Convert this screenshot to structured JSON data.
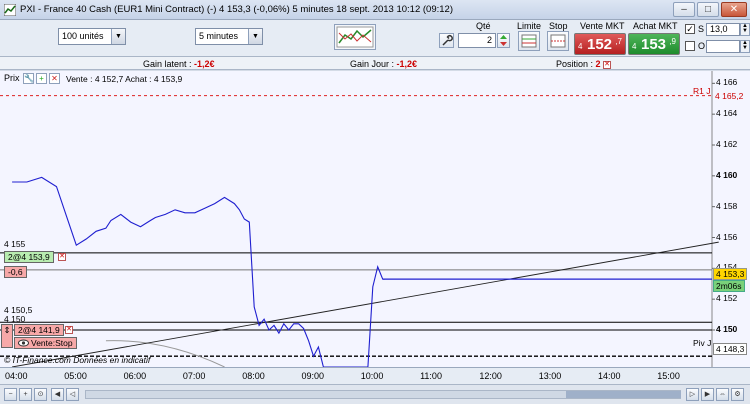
{
  "window": {
    "title": "PXI - France 40 Cash (EUR1 Mini Contract) (-)    4 153,3 (-0,06%)    5 minutes   18 sept. 2013 10:12 (09:12)",
    "min_glyph": "–",
    "max_glyph": "□",
    "close_glyph": "✕"
  },
  "toolbar": {
    "units": "100 unités",
    "period": "5 minutes",
    "qty_label": "Qté",
    "qty_value": "2",
    "limit_label": "Limite",
    "stop_label": "Stop",
    "sell_label": "Vente MKT",
    "buy_label": "Achat MKT",
    "sell_price": {
      "prefix": "4",
      "main": "152",
      "sup": ",7"
    },
    "buy_price": {
      "prefix": "4",
      "main": "153",
      "sup": ",9"
    },
    "s_label": "S",
    "o_label": "O",
    "s_value": "13,0",
    "o_value": ""
  },
  "infobar": {
    "latent_label": "Gain latent : ",
    "latent_value": "-1,2€",
    "day_label": "Gain Jour : ",
    "day_value": "-1,2€",
    "position_label": "Position : ",
    "position_value": "2"
  },
  "chart": {
    "prix_label": "Prix",
    "header": "Vente : 4 152,7 Achat : 4 153,9",
    "copyright": "© IT-Finance.com  Données en indicatif",
    "r1_label": "R1 J",
    "r1_value": "4 165,2",
    "piv_label": "Piv J",
    "piv_value": "4 148,3",
    "current_price": "4 153,3",
    "timer": "2m06s",
    "level_labels": {
      "l4155": "4 155",
      "l41505": "4 150,5",
      "l4150": "4 150"
    },
    "position_tag": "2@4 153,9",
    "pl_tag": "-0,6",
    "order_tag": "2@4 141,9",
    "order_button": "Vente:Stop"
  },
  "chart_data": {
    "type": "line",
    "y_ticks": [
      "4 166",
      "4 164",
      "4 162",
      "4 160",
      "4 158",
      "4 156",
      "4 154",
      "4 152",
      "4 150"
    ],
    "x_ticks": [
      "04:00",
      "05:00",
      "06:00",
      "07:00",
      "08:00",
      "09:00",
      "10:00",
      "11:00",
      "12:00",
      "13:00",
      "14:00",
      "15:00"
    ],
    "ylim": [
      4147.6,
      4166.8
    ],
    "series": [
      {
        "color": "#1f1fd0",
        "x": [
          "03:55",
          "04:10",
          "04:25",
          "04:40",
          "04:50",
          "05:00",
          "05:10",
          "05:20",
          "05:30",
          "05:35",
          "05:45",
          "05:55",
          "06:05",
          "06:15",
          "06:20",
          "06:30",
          "06:40",
          "06:50",
          "07:00",
          "07:10",
          "07:20",
          "07:30",
          "07:40",
          "07:45",
          "07:50",
          "07:55",
          "08:00",
          "08:05",
          "08:10",
          "08:15",
          "08:20",
          "08:25",
          "08:30",
          "08:35",
          "08:40",
          "08:45",
          "08:50",
          "08:55",
          "09:00",
          "09:05",
          "09:10",
          "09:55",
          "10:00",
          "10:05",
          "10:10",
          "10:12"
        ],
        "y": [
          4159.6,
          4159.6,
          4159.9,
          4159.3,
          4157.4,
          4155.5,
          4155.9,
          4156.4,
          4156.6,
          4157.1,
          4157.5,
          4157.0,
          4156.7,
          4157.1,
          4157.3,
          4157.5,
          4157.8,
          4157.6,
          4157.6,
          4157.9,
          4158.2,
          4158.6,
          4158.2,
          4157.8,
          4157.2,
          4157.0,
          4151.5,
          4150.3,
          4150.7,
          4150.0,
          4150.3,
          4149.8,
          4150.4,
          4150.0,
          4150.4,
          4150.4,
          4150.1,
          4149.3,
          4148.3,
          4148.9,
          4147.6,
          4147.6,
          4152.8,
          4154.1,
          4153.3,
          4153.3
        ]
      }
    ],
    "trendline": {
      "x": [
        "03:55",
        "15:50"
      ],
      "y": [
        4147.6,
        4155.7
      ]
    },
    "pivot_curve": {
      "x": [
        "05:30",
        "07:30"
      ],
      "y": [
        4149.3,
        4147.6
      ]
    },
    "levels": [
      4165.2,
      4155.0,
      4153.9,
      4153.3,
      4150.5,
      4150.0,
      4148.3
    ],
    "grid": false
  }
}
